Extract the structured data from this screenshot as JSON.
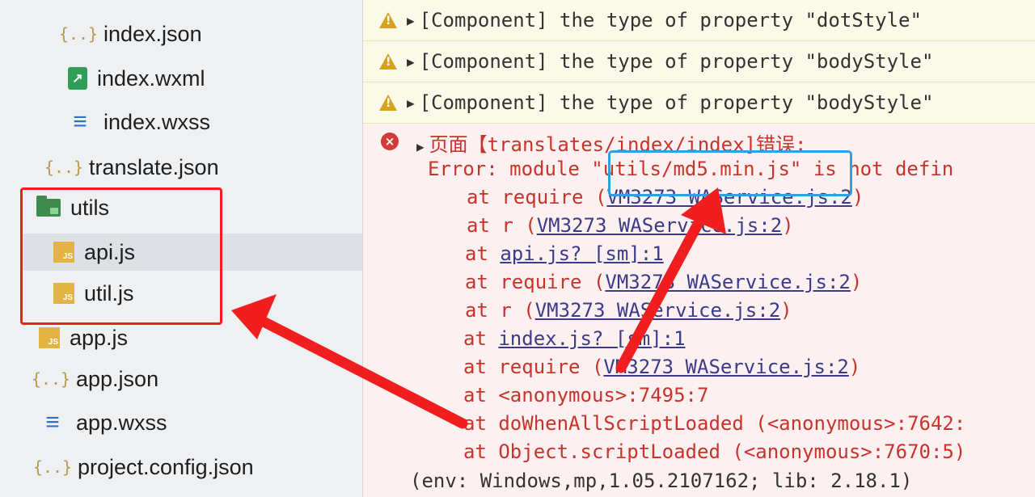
{
  "file_tree": {
    "items": [
      {
        "name": "index.json",
        "icon": "json-file-icon"
      },
      {
        "name": "index.wxml",
        "icon": "wxml-file-icon"
      },
      {
        "name": "index.wxss",
        "icon": "wxss-file-icon"
      },
      {
        "name": "translate.json",
        "icon": "json-file-icon"
      },
      {
        "name": "utils",
        "icon": "folder-icon"
      },
      {
        "name": "api.js",
        "icon": "js-file-icon"
      },
      {
        "name": "util.js",
        "icon": "js-file-icon"
      },
      {
        "name": "app.js",
        "icon": "js-file-icon"
      },
      {
        "name": "app.json",
        "icon": "json-file-icon"
      },
      {
        "name": "app.wxss",
        "icon": "wxss-file-icon"
      },
      {
        "name": "project.config.json",
        "icon": "json-file-icon"
      }
    ]
  },
  "console": {
    "warnings": [
      "[Component] the type of property \"dotStyle\"",
      "[Component] the type of property \"bodyStyle\"",
      "[Component] the type of property \"bodyStyle\""
    ],
    "error": {
      "header": "页面【translates/index/index]错误:",
      "message_prefix": "Error: module ",
      "module": "\"utils/md5.min.js\"",
      "message_suffix": " is not defin",
      "stack": [
        {
          "at": "at",
          "fn": "require (",
          "link": "VM3273 WAService.js:2",
          "end": ")"
        },
        {
          "at": "at",
          "fn": "r (",
          "link": "VM3273 WAService.js:2",
          "end": ")"
        },
        {
          "at": "at",
          "fn": "",
          "link": "api.js? [sm]:1",
          "end": ""
        },
        {
          "at": "at",
          "fn": "require (",
          "link": "VM3273 WAService.js:2",
          "end": ")"
        },
        {
          "at": "at",
          "fn": "r (",
          "link": "VM3273 WAService.js:2",
          "end": ")"
        },
        {
          "at": "at",
          "fn": "",
          "link": "index.js? [sm]:1",
          "end": ""
        },
        {
          "at": "at",
          "fn": "require (",
          "link": "VM3273 WAService.js:2",
          "end": ")"
        },
        {
          "at": "at",
          "fn": "<anonymous>:7495:7",
          "link": "",
          "end": ""
        },
        {
          "at": "at",
          "fn": "doWhenAllScriptLoaded (<anonymous>:7642:",
          "link": "",
          "end": ""
        },
        {
          "at": "at",
          "fn": "Object.scriptLoaded (<anonymous>:7670:5)",
          "link": "",
          "end": ""
        }
      ],
      "env": "(env: Windows,mp,1.05.2107162; lib: 2.18.1)"
    }
  },
  "colors": {
    "annotation_red": "#f01e1e",
    "annotation_blue": "#2aa3e6",
    "error_text": "#c8332b",
    "warning_bg": "#fbf9e8",
    "error_bg": "#fdf0f0"
  }
}
